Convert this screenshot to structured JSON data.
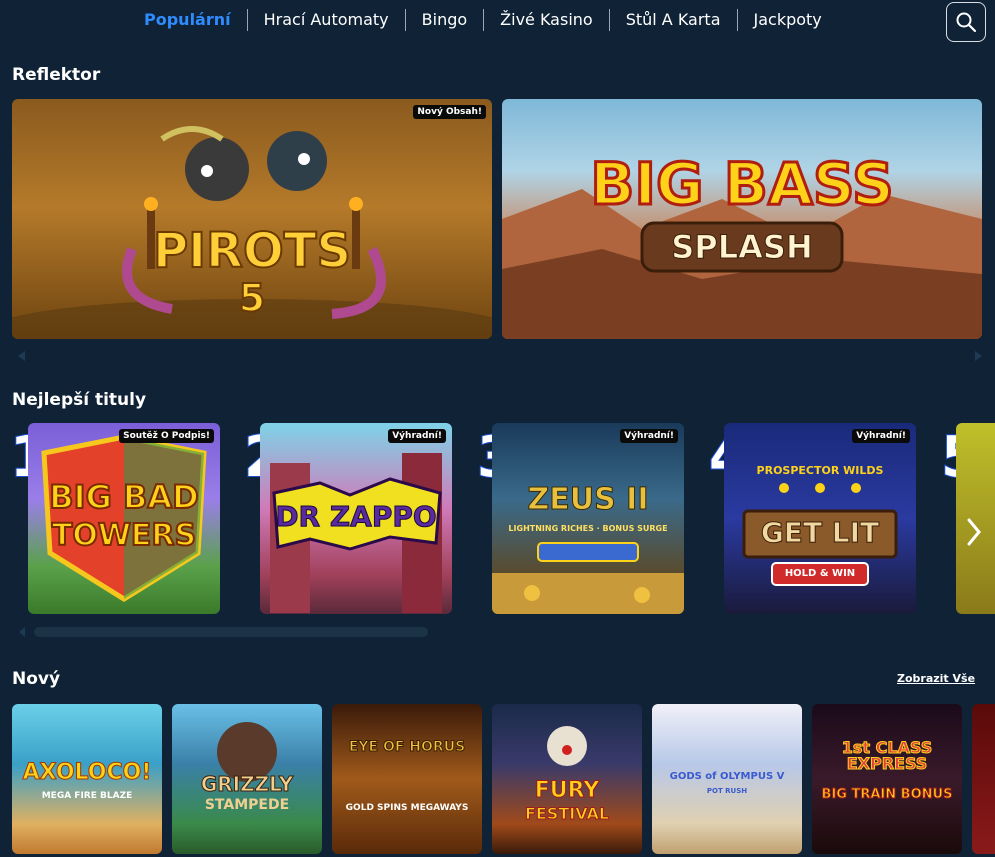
{
  "nav": {
    "items": [
      "Populární",
      "Hrací Automaty",
      "Bingo",
      "Živé Kasino",
      "Stůl A Karta",
      "Jackpoty"
    ],
    "active": "Populární"
  },
  "search": {
    "icon": "search-icon"
  },
  "spotlight": {
    "title": "Reflektor",
    "games": [
      {
        "name_line1": "PIROTS",
        "name_line2": "5",
        "badge": "Nový Obsah!"
      },
      {
        "name_line1": "BIG BASS",
        "name_line2": "SPLASH",
        "badge": ""
      }
    ]
  },
  "top": {
    "title": "Nejlepší tituly",
    "games": [
      {
        "rank": "1",
        "name_line1": "BIG BAD",
        "name_line2": "TOWERS",
        "badge": "Soutěž O Podpis!"
      },
      {
        "rank": "2",
        "name_line1": "DR ZAPPO",
        "name_line2": "",
        "badge": "Výhradní!"
      },
      {
        "rank": "3",
        "name_line1": "ZEUS II",
        "name_line2": "LIGHTNING RICHES · BONUS SURGE",
        "badge": "Výhradní!"
      },
      {
        "rank": "4",
        "name_line1": "PROSPECTOR WILDS",
        "name_line2": "GET LIT",
        "name_line3": "HOLD & WIN",
        "badge": "Výhradní!"
      },
      {
        "rank": "5",
        "name_line1": "",
        "name_line2": "",
        "badge": ""
      }
    ]
  },
  "new": {
    "title": "Nový",
    "view_all": "Zobrazit Vše",
    "games": [
      {
        "name_line1": "AXOLOCO!",
        "name_line2": "MEGA FIRE BLAZE"
      },
      {
        "name_line1": "GRIZZLY",
        "name_line2": "STAMPEDE"
      },
      {
        "name_line1": "EYE OF HORUS",
        "name_line2": "GOLD SPINS MEGAWAYS"
      },
      {
        "name_line1": "FURY",
        "name_line2": "FESTIVAL"
      },
      {
        "name_line1": "GODS of OLYMPUS V",
        "name_line2": "POT RUSH"
      },
      {
        "name_line1": "1st CLASS EXPRESS",
        "name_line2": "BIG TRAIN BONUS"
      }
    ]
  }
}
